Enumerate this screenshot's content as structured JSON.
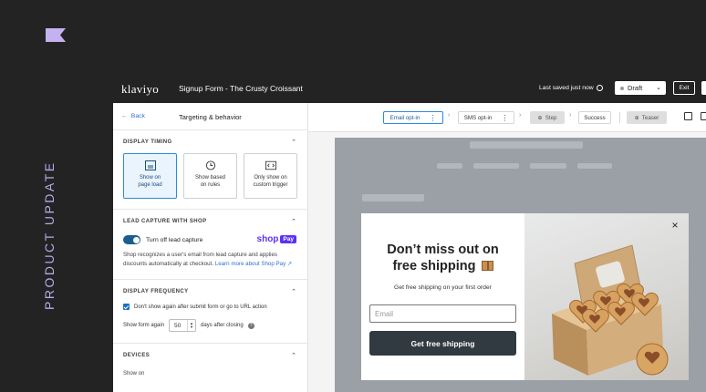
{
  "side_label": "PRODUCT UPDATE",
  "colors": {
    "accent_purple": "#b9a8e8",
    "shop_purple": "#5a31f4",
    "primary_blue": "#2e8bd9",
    "cta_dark": "#323a41"
  },
  "topbar": {
    "logo": "klaviyo",
    "form_title": "Signup Form - The Crusty Croissant",
    "saved_text": "Last saved just now",
    "draft_label": "Draft",
    "exit_label": "Exit"
  },
  "panel": {
    "back_label": "Back",
    "title": "Targeting & behavior",
    "display_timing": {
      "title": "DISPLAY TIMING",
      "options": [
        {
          "line1": "Show on",
          "line2": "page load",
          "icon": "page-load-icon"
        },
        {
          "line1": "Show based",
          "line2": "on rules",
          "icon": "clock-icon"
        },
        {
          "line1": "Only show on",
          "line2": "custom trigger",
          "icon": "code-icon"
        }
      ]
    },
    "lead_capture": {
      "title": "LEAD CAPTURE WITH SHOP",
      "toggle_label": "Turn off lead capture",
      "shop_word": "shop",
      "pay_word": "Pay",
      "description": "Shop recognizes a user's email from lead capture and applies discounts automatically at checkout.",
      "link": "Learn more about Shop Pay"
    },
    "display_frequency": {
      "title": "DISPLAY FREQUENCY",
      "checkbox_label": "Don't show again after submit form or go to URL action",
      "again_label": "Show form again",
      "again_value": "50",
      "again_suffix": "days after closing",
      "help": "?"
    },
    "devices": {
      "title": "DEVICES",
      "show_on": "Show on"
    }
  },
  "steps": {
    "email_optin": "Email opt-in",
    "sms_optin": "SMS opt-in",
    "step": "Step",
    "success": "Success",
    "teaser": "Teaser"
  },
  "popup": {
    "headline_line1": "Don’t miss out on",
    "headline_line2": "free shipping",
    "subline": "Get free shipping on your first order",
    "email_placeholder": "Email",
    "cta_label": "Get free shipping",
    "close": "×"
  }
}
